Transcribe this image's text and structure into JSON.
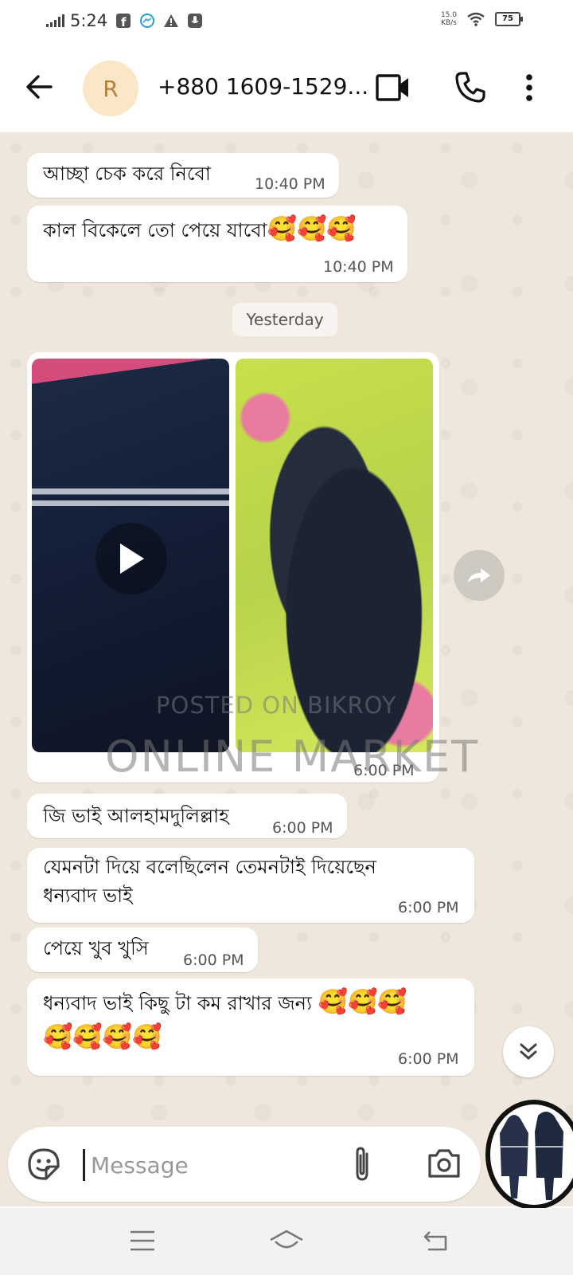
{
  "status_bar": {
    "time": "5:24",
    "net_speed_value": "15.0",
    "net_speed_unit": "KB/s",
    "battery": "75",
    "icons": [
      "signal-icon",
      "facebook-icon",
      "messenger-icon",
      "warning-icon",
      "voice-recorder-icon",
      "wifi-icon",
      "battery-icon"
    ]
  },
  "header": {
    "avatar_letter": "R",
    "contact_name": "+880 1609-1529...",
    "icons": [
      "back-arrow-icon",
      "video-call-icon",
      "phone-call-icon",
      "more-vert-icon"
    ]
  },
  "messages": [
    {
      "text": "আচ্ছা চেক করে নিবো",
      "time": "10:40 PM"
    },
    {
      "text": "কাল বিকেলে তো পেয়ে যাবো",
      "emojis": "🥰🥰🥰",
      "time": "10:40 PM"
    },
    {
      "date_divider": "Yesterday"
    },
    {
      "type": "media",
      "items": [
        "video",
        "photo"
      ],
      "time": "6:00 PM"
    },
    {
      "text": "জি ভাই আলহামদুলিল্লাহ",
      "time": "6:00 PM"
    },
    {
      "text_line1": "যেমনটা দিয়ে বলেছিলেন তেমনটাই দিয়েছেন",
      "text_line2": "ধন্যবাদ ভাই",
      "time": "6:00 PM"
    },
    {
      "text": "পেয়ে খুব খুসি",
      "time": "6:00 PM"
    },
    {
      "text": "ধন্যবাদ ভাই কিছু টা কম রাখার জন্য",
      "emojis_line1": "🥰🥰🥰",
      "emojis_line2": "🥰🥰🥰🥰",
      "time": "6:00 PM"
    }
  ],
  "watermark": {
    "line1": "POSTED ON BIKROY",
    "line2": "ONLINE MARKET"
  },
  "composer": {
    "placeholder": "Message",
    "icons": [
      "sticker-icon",
      "attach-icon",
      "camera-icon"
    ]
  },
  "nav_bar": {
    "icons": [
      "menu-icon",
      "home-icon",
      "back-icon"
    ]
  },
  "colors": {
    "chat_background": "#efe7db",
    "bubble": "#ffffff",
    "avatar_bg": "#fbe6c7",
    "avatar_fg": "#b5813a"
  }
}
